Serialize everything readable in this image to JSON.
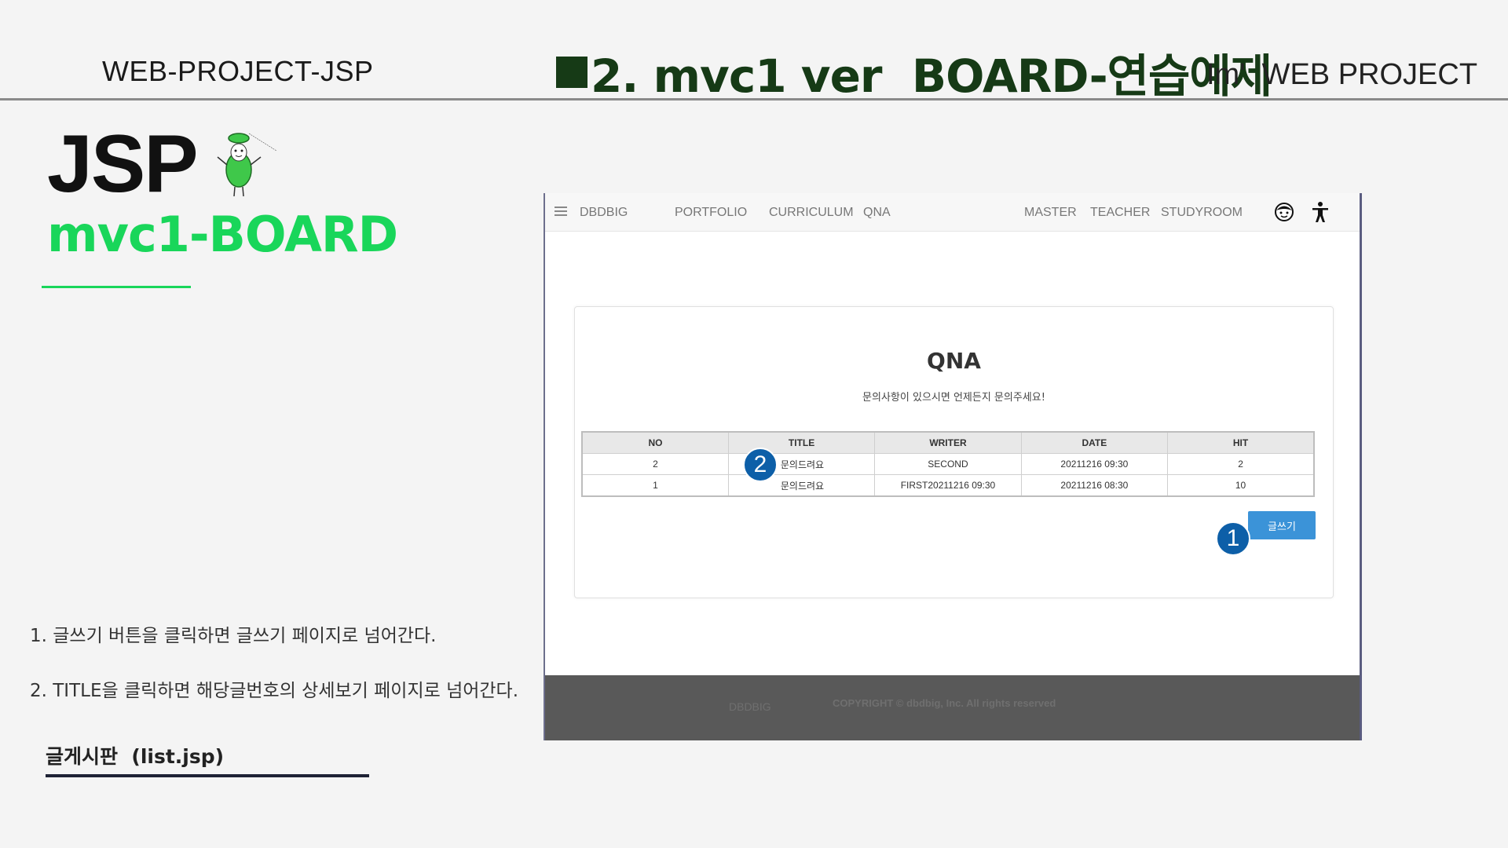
{
  "slide": {
    "header_left": "WEB-PROJECT-JSP",
    "header_center": "2. mvc1 ver  BOARD-연습예제",
    "header_right": "Im'  WEB PROJECT",
    "main_title": "JSP",
    "sub_title": "mvc1-BOARD",
    "accent_color": "#19d65a",
    "notes": [
      "1. 글쓰기 버튼을 클릭하면 글쓰기 페이지로 넘어간다.",
      "2. TITLE을 클릭하면 해당글번호의 상세보기 페이지로 넘어간다."
    ],
    "file_label": "글게시판  (list.jsp)"
  },
  "browser": {
    "nav": {
      "menu_icon": "hamburger-icon",
      "brand": "DBDBIG",
      "left_items": [
        "PORTFOLIO",
        "CURRICULUM",
        "QNA"
      ],
      "right_items": [
        "MASTER",
        "TEACHER",
        "STUDYROOM"
      ],
      "icons": [
        "face-icon",
        "accessibility-icon"
      ]
    },
    "board": {
      "title": "QNA",
      "description": "문의사항이 있으시면 언제든지 문의주세요!",
      "columns": [
        "NO",
        "TITLE",
        "WRITER",
        "DATE",
        "HIT"
      ],
      "rows": [
        {
          "no": "2",
          "title": "문의드려요",
          "writer": "SECOND",
          "date": "20211216 09:30",
          "hit": "2"
        },
        {
          "no": "1",
          "title": "문의드려요",
          "writer": "FIRST20211216 09:30",
          "date": "20211216 08:30",
          "hit": "10"
        }
      ],
      "write_button": "글쓰기",
      "button_color": "#3b93d8"
    },
    "footer": {
      "brand": "DBDBIG",
      "copyright": "COPYRIGHT © dbdbig, Inc. All rights reserved"
    }
  },
  "badges": [
    "1",
    "2"
  ]
}
